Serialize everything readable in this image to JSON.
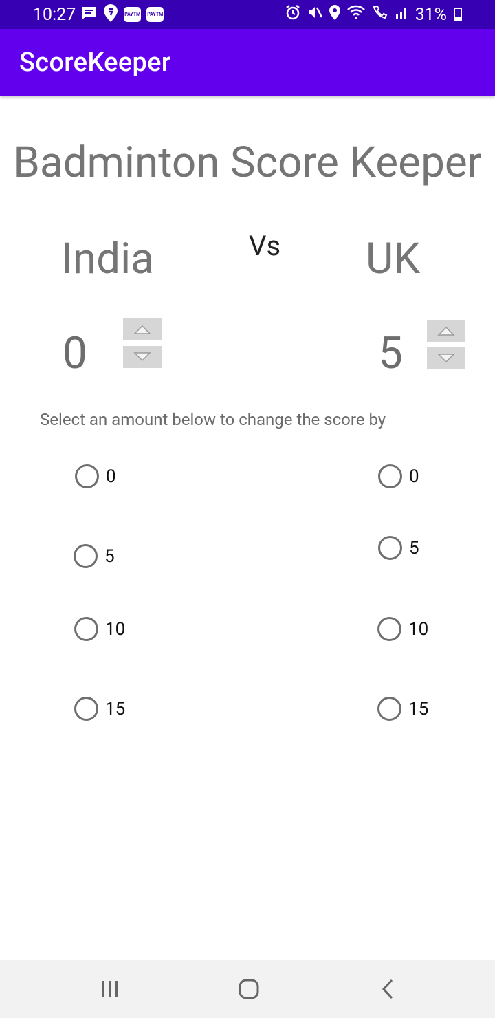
{
  "status_bar": {
    "time": "10:27",
    "notification_chips": [
      "PAYTM",
      "PAYTM"
    ],
    "battery_percent": "31%",
    "icons_left": [
      "chat-bubble-icon",
      "swiggy-icon",
      "paytm-icon",
      "paytm-icon"
    ],
    "icons_right": [
      "alarm-icon",
      "mute-icon",
      "location-icon",
      "wifi-icon",
      "wifi-calling-icon",
      "signal-icon",
      "battery-icon"
    ]
  },
  "app_bar": {
    "title": "ScoreKeeper",
    "background": "#6200ee"
  },
  "main": {
    "heading": "Badminton Score Keeper",
    "vs_label": "Vs",
    "instruction": "Select an amount below to change the score by",
    "teams": [
      {
        "name": "India",
        "score": "0",
        "options": [
          "0",
          "5",
          "10",
          "15"
        ]
      },
      {
        "name": "UK",
        "score": "5",
        "options": [
          "0",
          "5",
          "10",
          "15"
        ]
      }
    ]
  },
  "nav_bar": {
    "buttons": [
      "recents-icon",
      "home-icon",
      "back-icon"
    ]
  },
  "colors": {
    "status_bar": "#3700b3",
    "accent": "#6200ee",
    "text_gray": "#757575"
  }
}
